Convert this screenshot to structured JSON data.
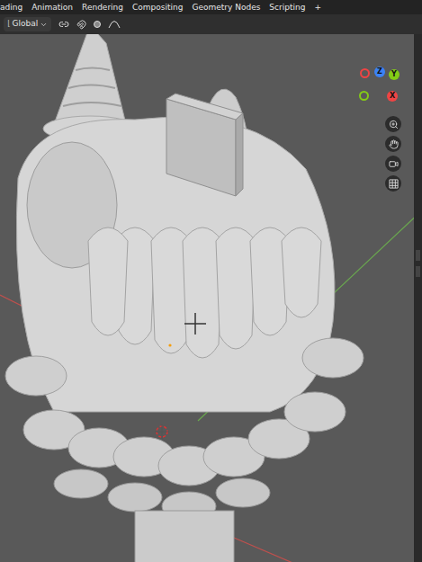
{
  "workspace_tabs": [
    {
      "label": "ading",
      "selected": false
    },
    {
      "label": "Animation",
      "selected": false
    },
    {
      "label": "Rendering",
      "selected": false
    },
    {
      "label": "Compositing",
      "selected": false
    },
    {
      "label": "Geometry Nodes",
      "selected": false
    },
    {
      "label": "Scripting",
      "selected": false
    }
  ],
  "add_tab": "+",
  "toolbar": {
    "orientation": "Global"
  },
  "gizmo": {
    "axes": [
      {
        "label": "Z",
        "color": "#3b82f6"
      },
      {
        "label": "Y",
        "color": "#84cc16"
      },
      {
        "label": "X",
        "color": "#ef4444"
      }
    ],
    "negative_axes": [
      {
        "color": "#ef4444"
      },
      {
        "color": "#84cc16"
      }
    ]
  }
}
